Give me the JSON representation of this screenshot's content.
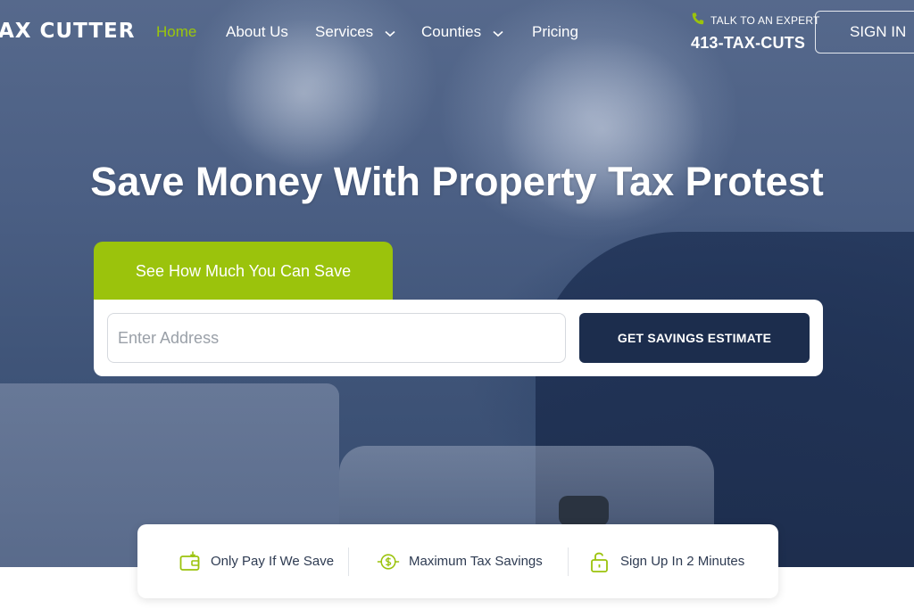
{
  "header": {
    "logo_text": "AX CUTTER",
    "nav": [
      {
        "label": "Home",
        "active": true,
        "dropdown": false
      },
      {
        "label": "About Us",
        "active": false,
        "dropdown": false
      },
      {
        "label": "Services",
        "active": false,
        "dropdown": true
      },
      {
        "label": "Counties",
        "active": false,
        "dropdown": true
      },
      {
        "label": "Pricing",
        "active": false,
        "dropdown": false
      }
    ],
    "talk_label": "TALK TO AN EXPERT",
    "phone": "413-TAX-CUTS",
    "sign_in": "SIGN IN"
  },
  "hero": {
    "headline": "Save Money With Property Tax Protest"
  },
  "estimator": {
    "tab_label": "See How Much You Can Save",
    "address_placeholder": "Enter Address",
    "address_value": "",
    "button_label": "GET SAVINGS ESTIMATE"
  },
  "features": [
    {
      "label": "Only Pay If We Save",
      "icon": "wallet-icon"
    },
    {
      "label": "Maximum Tax Savings",
      "icon": "dollar-icon"
    },
    {
      "label": "Sign Up In 2 Minutes",
      "icon": "unlock-icon"
    }
  ],
  "colors": {
    "accent_green": "#9bc30c",
    "navy": "#1c2d4d",
    "text_dark": "#2e3b52"
  }
}
